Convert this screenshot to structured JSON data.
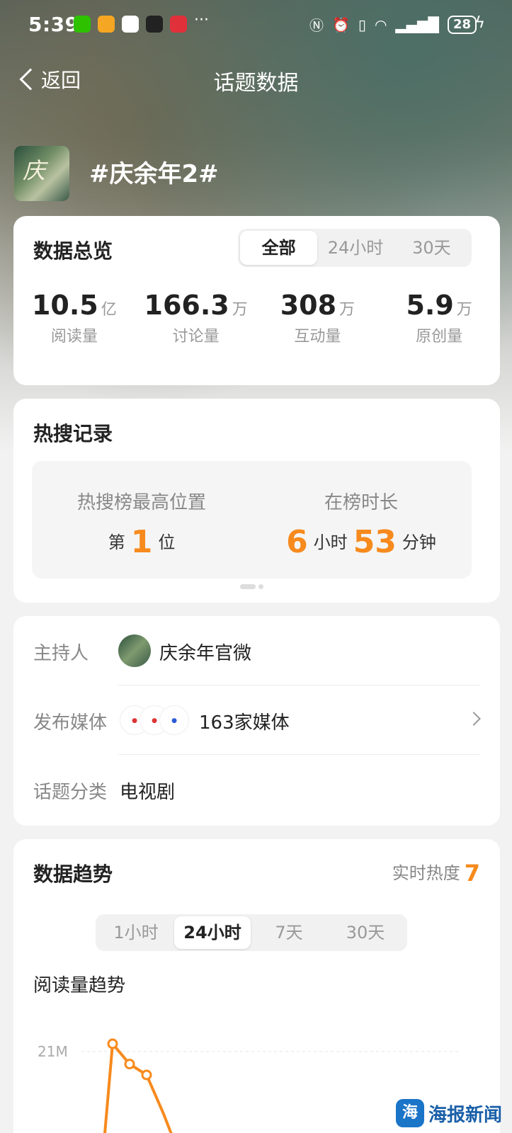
{
  "status_bar": {
    "time": "5:39",
    "more": "···",
    "battery": "28"
  },
  "nav": {
    "back_label": "返回",
    "title": "话题数据"
  },
  "topic": {
    "title": "#庆余年2#",
    "thumb_text": "庆"
  },
  "overview": {
    "title": "数据总览",
    "tabs": [
      "全部",
      "24小时",
      "30天"
    ],
    "active_tab": "全部",
    "stats": [
      {
        "value": "10.5",
        "unit": "亿",
        "label": "阅读量"
      },
      {
        "value": "166.3",
        "unit": "万",
        "label": "讨论量"
      },
      {
        "value": "308",
        "unit": "万",
        "label": "互动量"
      },
      {
        "value": "5.9",
        "unit": "万",
        "label": "原创量"
      }
    ]
  },
  "hot_search": {
    "title": "热搜记录",
    "peak_label": "热搜榜最高位置",
    "peak_prefix": "第",
    "peak_value": "1",
    "peak_suffix": "位",
    "duration_label": "在榜时长",
    "hours_value": "6",
    "hours_unit": "小时",
    "minutes_value": "53",
    "minutes_unit": "分钟"
  },
  "info": {
    "host_label": "主持人",
    "host_name": "庆余年官微",
    "media_label": "发布媒体",
    "media_value": "163家媒体",
    "category_label": "话题分类",
    "category_value": "电视剧"
  },
  "trend": {
    "title": "数据趋势",
    "heat_label": "实时热度",
    "heat_value": "7",
    "tabs": [
      "1小时",
      "24小时",
      "7天",
      "30天"
    ],
    "active_tab": "24小时",
    "chart_title": "阅读量趋势"
  },
  "chart_data": {
    "type": "line",
    "title": "阅读量趋势",
    "y_ticks": [
      "21M"
    ],
    "series": [
      {
        "values": [
          21.5,
          20.2,
          19.5,
          17.0
        ]
      }
    ],
    "grid": true
  },
  "watermark": {
    "text": "海报新闻",
    "badge": "海"
  },
  "colors": {
    "accent": "#f78a1d",
    "card": "#ffffff",
    "background": "#f2f2f2"
  }
}
